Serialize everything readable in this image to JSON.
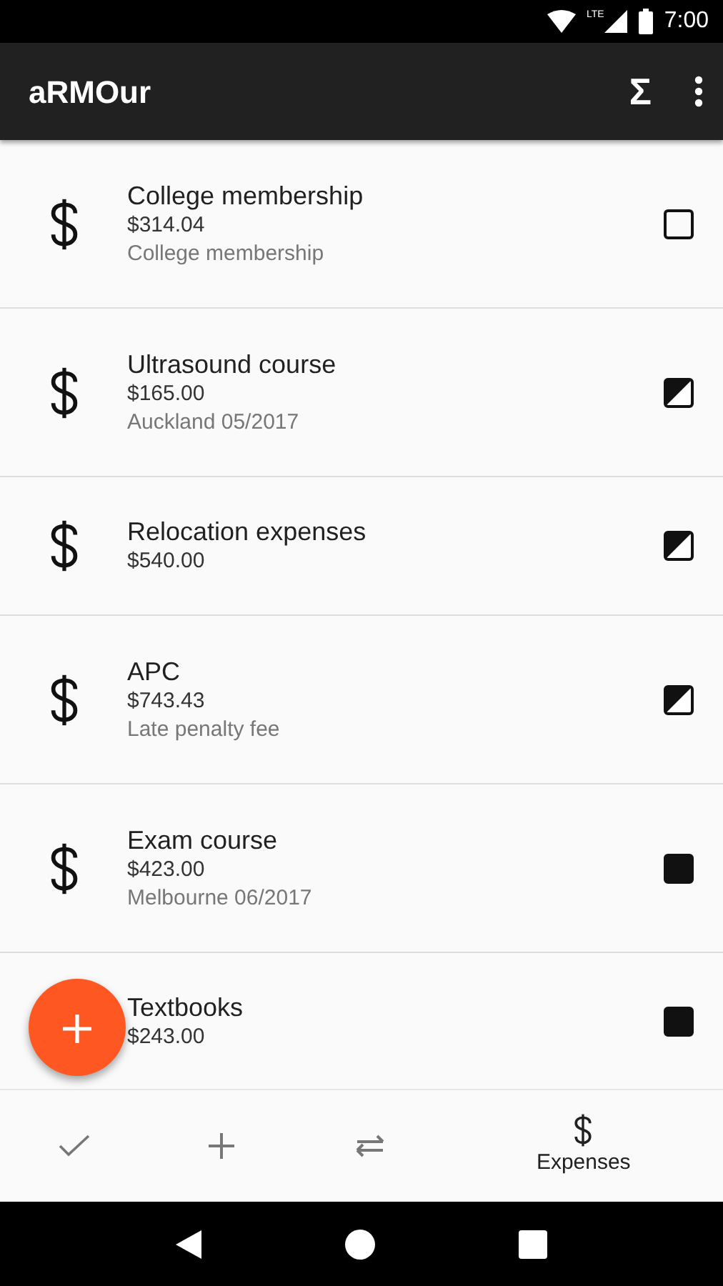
{
  "status_bar": {
    "network": "LTE",
    "time": "7:00"
  },
  "app_bar": {
    "title": "aRMOur",
    "sum_icon": "Σ"
  },
  "expenses": [
    {
      "title": "College membership",
      "amount": "$314.04",
      "note": "College membership",
      "kind": "empty"
    },
    {
      "title": "Ultrasound course",
      "amount": "$165.00",
      "note": "Auckland 05/2017",
      "kind": "half"
    },
    {
      "title": "Relocation expenses",
      "amount": "$540.00",
      "kind": "half"
    },
    {
      "title": "APC",
      "amount": "$743.43",
      "note": "Late penalty fee",
      "kind": "half"
    },
    {
      "title": "Exam course",
      "amount": "$423.00",
      "note": "Melbourne 06/2017",
      "kind": "full"
    },
    {
      "title": "Textbooks",
      "amount": "$243.00",
      "kind": "full"
    }
  ],
  "bottom_nav": [
    {
      "kind": "check",
      "selected": false
    },
    {
      "kind": "add",
      "selected": false
    },
    {
      "kind": "transfer",
      "selected": false
    },
    {
      "kind": "expenses",
      "label": "Expenses",
      "selected": true
    }
  ]
}
